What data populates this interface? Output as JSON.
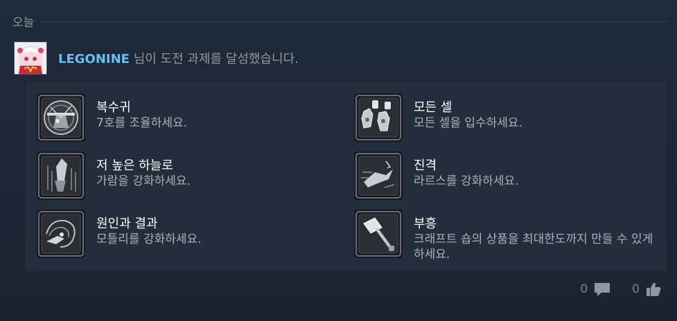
{
  "date_header": {
    "label": "오늘"
  },
  "activity": {
    "username": "LEGONINE",
    "message": " 님이 도전 과제를 달성했습니다."
  },
  "achievements": [
    {
      "title": "복수귀",
      "description": "7호를 조율하세요.",
      "icon": "clock-gear-robot-icon"
    },
    {
      "title": "모든 셀",
      "description": "모든 셀을 입수하세요.",
      "icon": "cells-icon"
    },
    {
      "title": "저 높은 하늘로",
      "description": "가람을 강화하세요.",
      "icon": "rocket-figure-icon"
    },
    {
      "title": "진격",
      "description": "라르스를 강화하세요.",
      "icon": "charging-figure-icon"
    },
    {
      "title": "원인과 결과",
      "description": "모틀리를 강화하세요.",
      "icon": "spiral-figure-icon"
    },
    {
      "title": "부흥",
      "description": "크래프트 숍의 상품을 최대한도까지 만들 수 있게 하세요.",
      "icon": "hammer-icon"
    }
  ],
  "footer": {
    "comments_count": "0",
    "likes_count": "0"
  },
  "colors": {
    "background": "#1e2837",
    "panel": "#232d3b",
    "username": "#66c0f4",
    "muted_text": "#8f98a0"
  }
}
